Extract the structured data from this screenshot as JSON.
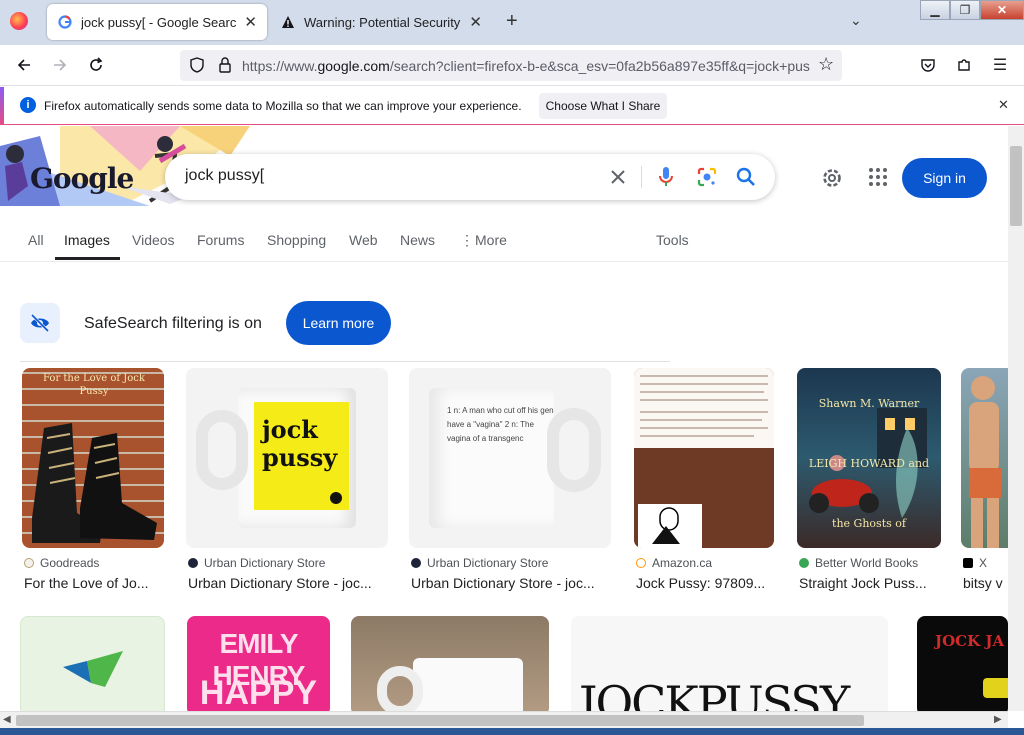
{
  "browser": {
    "tabs": [
      {
        "title": "jock pussy[ - Google Search",
        "active": true
      },
      {
        "title": "Warning: Potential Security Risk",
        "active": false
      }
    ],
    "new_tab": "+",
    "url_prefix": "https://www.",
    "url_domain": "google.com",
    "url_rest": "/search?client=firefox-b-e&sca_esv=0fa2b56a897e35ff&q=jock+pus",
    "notification_text": "Firefox automatically sends some data to Mozilla so that we can improve your experience.",
    "notification_button": "Choose What I Share"
  },
  "google": {
    "logo_text": "Google",
    "query": "jock pussy[",
    "sign_in": "Sign in",
    "tabs": [
      "All",
      "Images",
      "Videos",
      "Forums",
      "Shopping",
      "Web",
      "News",
      "More",
      "Tools"
    ],
    "active_tab": "Images",
    "safesearch_text": "SafeSearch filtering is on",
    "learn_more": "Learn more"
  },
  "results": [
    {
      "source": "Goodreads",
      "title": "For the Love of Jo...",
      "image_text": "For the Love of Jock Pussy"
    },
    {
      "source": "Urban Dictionary Store",
      "title": "Urban Dictionary Store - joc...",
      "image_text": "jock pussy"
    },
    {
      "source": "Urban Dictionary Store",
      "title": "Urban Dictionary Store - joc...",
      "image_text": "1 n: A man who cut off his gen have a \"vagina\" 2 n: The vagina of a transgenc"
    },
    {
      "source": "Amazon.ca",
      "title": "Jock Pussy: 97809...",
      "image_text": ""
    },
    {
      "source": "Better World Books",
      "title": "Straight Jock Puss...",
      "image_text": "Shawn M. Warner LEIGH HOWARD and the Ghosts of"
    },
    {
      "source": "X",
      "title": "bitsy v",
      "image_text": ""
    }
  ],
  "row2": {
    "book_title_1": "EMILY HENRY",
    "book_title_2": "HAPPY",
    "big_text": "JOCKPUSSY",
    "dark_text": "JOCK JA"
  },
  "colors": {
    "accent": "#0b57d0",
    "tab_bg": "#d3dcea"
  }
}
